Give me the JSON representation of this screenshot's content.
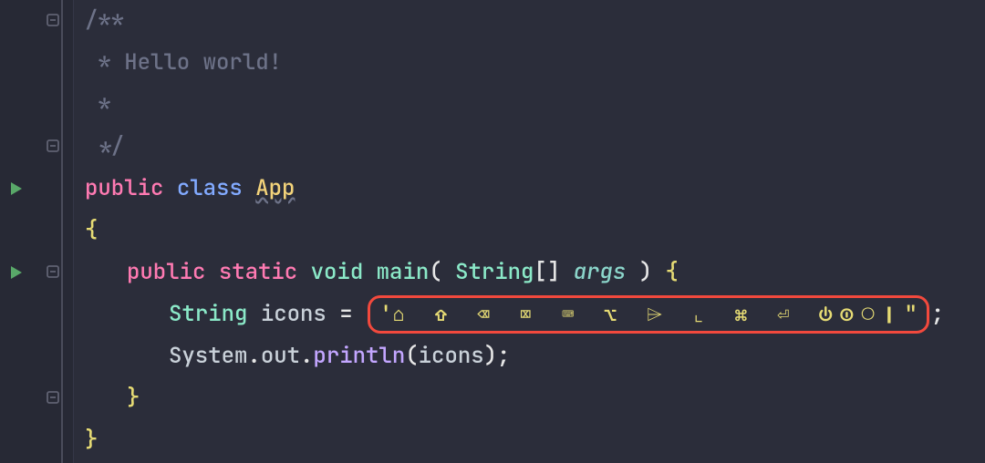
{
  "file": "App.java",
  "code": {
    "doc_open": "/**",
    "doc_line": " * Hello world!",
    "doc_empty": " *",
    "doc_close": " */",
    "public": "public",
    "class": "class",
    "class_name": "App",
    "brace_open": "{",
    "brace_close": "}",
    "static": "static",
    "void": "void",
    "main": "main",
    "paren_open": "(",
    "paren_close": ")",
    "sp": " ",
    "String": "String",
    "brackets": "[]",
    "args": "args",
    "icons_var": "icons",
    "equals": " = ",
    "str_open": "'",
    "str_icons": "⌂ ⇧ ⌫ ⌧ ⌨ ⌥ ⌲ ⌞ ⌘ ⏎ ⏻⏼◯❙",
    "str_close": "\"",
    "semi": ";",
    "System": "System",
    "dot": ".",
    "out": "out",
    "println": "println",
    "icons_ref": "icons"
  }
}
